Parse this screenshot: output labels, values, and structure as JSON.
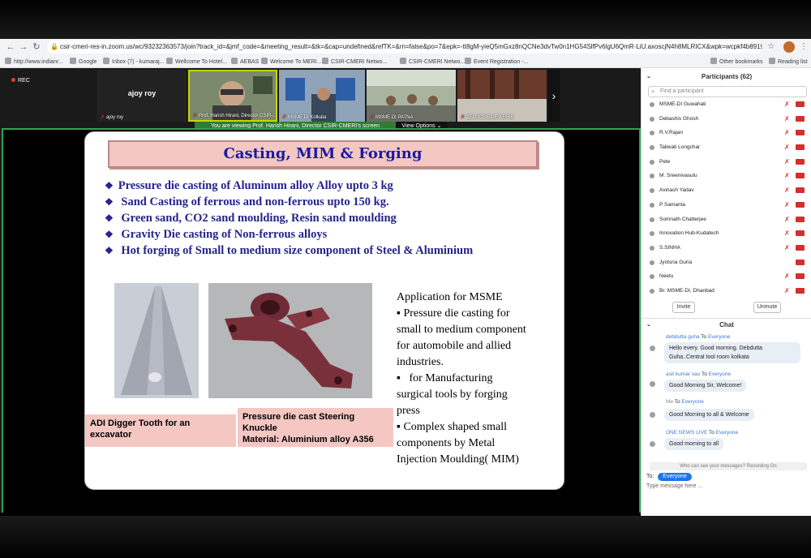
{
  "browser": {
    "url": "csir-cmeri-res-in.zoom.us/wc/93232363573/join?track_id=&jmf_code=&meeting_result=&tk=&cap=undefined&refTK=&rn=false&po=7&epk=-tt8gM-yieQ5mGxz8nQCNe3dvTw0n1HG54SlfPv6lgU6QmR-LiU.axoscjN4h8MLRICX&wpk=wcpkf4b891960b8c00353d...",
    "bookmarks": [
      "http://www.indianr...",
      "Google",
      "Inbox (7) - kumaraj...",
      "Wellcome To Hotel...",
      "AEBAS",
      "Welcome To MERI...",
      "CSIR-CMERI Netwo...",
      "CSIR-CMERI Netwo...",
      "Event Registration -..."
    ],
    "other_bookmarks": "Other bookmarks",
    "reading_list": "Reading list"
  },
  "meeting": {
    "rec_label": "REC",
    "tiles": [
      {
        "name": "ajoy roy",
        "center": "ajoy roy"
      },
      {
        "name": "Prof. Harish Hirani, Director CSIR-..."
      },
      {
        "name": "MSME DI Kolkata"
      },
      {
        "name": "MSME DI PATNA"
      },
      {
        "name": "ZELUOSIELIE KEHIE"
      }
    ],
    "viewing_banner": "You are viewing Prof. Harish Hirani, Director CSIR-CMERI's screen",
    "view_options": "View Options ⌄"
  },
  "slide": {
    "title": "Casting, MIM & Forging",
    "bullets": [
      "Pressure die casting of Aluminum alloy  Alloy upto 3 kg",
      " Sand Casting of ferrous and non-ferrous  upto 150 kg.",
      " Green sand, CO2 sand  moulding, Resin sand moulding",
      " Gravity Die casting of Non-ferrous alloys",
      " Hot forging of Small to medium size component of  Steel & Aluminium"
    ],
    "caption_tooth": [
      "ADI Digger Tooth for an",
      " excavator"
    ],
    "caption_knuckle": [
      "Pressure die cast Steering",
      "Knuckle",
      "Material: Aluminium alloy A356"
    ],
    "application_lines": [
      "Application for MSME",
      "▪ Pressure die casting for",
      "small to medium component",
      "for automobile and allied",
      "industries.",
      "▪   for Manufacturing",
      "surgical tools by forging",
      "press",
      "▪ Complex shaped small",
      "components by Metal",
      "Injection Moulding( MIM)"
    ]
  },
  "participants": {
    "title": "Participants (62)",
    "search_placeholder": "Find a participant",
    "list": [
      "MSME-DI Guwahati",
      "Debashis Ghosh",
      "R.V.Rajan",
      "Taliwati Longchar",
      "Pete",
      "M. Sreenivasulu",
      "Avinash Yadav",
      "P Samanta",
      "Somnath Chatterjee",
      "Innovation Hub-Kudatech",
      "S.SINHA",
      "Jyotsna Guria",
      "Neetu",
      "Br. MSME-DI, Dhanbad"
    ],
    "invite": "Invite",
    "unmute": "Unmute"
  },
  "chat": {
    "title": "Chat",
    "messages": [
      {
        "from": "debdutta guha",
        "to": "Everyone",
        "text": [
          "Hello every. Good morning. Debdutta",
          "Guha..Central tool room kolkata"
        ]
      },
      {
        "from": "Good Morning Sir, Welcome!",
        "to": "",
        "text": [
          "Good Morning Sir, Welcome!"
        ]
      },
      {
        "from": "asit kumar sau",
        "to": "Everyone",
        "text": [
          "Good Morning Sir, Welcome!"
        ]
      },
      {
        "from": "Me",
        "to": "Everyone",
        "text": [
          "Good  Morning to all & Welcome"
        ]
      },
      {
        "from": "ONE NEWS LIVE",
        "to": "Everyone",
        "text": [
          "Good morning to all"
        ]
      }
    ],
    "to_word": "To",
    "who_can_see": "Who can see your messages? Recording On",
    "to_label": "To:",
    "to_value": "Everyone",
    "input_placeholder": "Type message here ..."
  }
}
